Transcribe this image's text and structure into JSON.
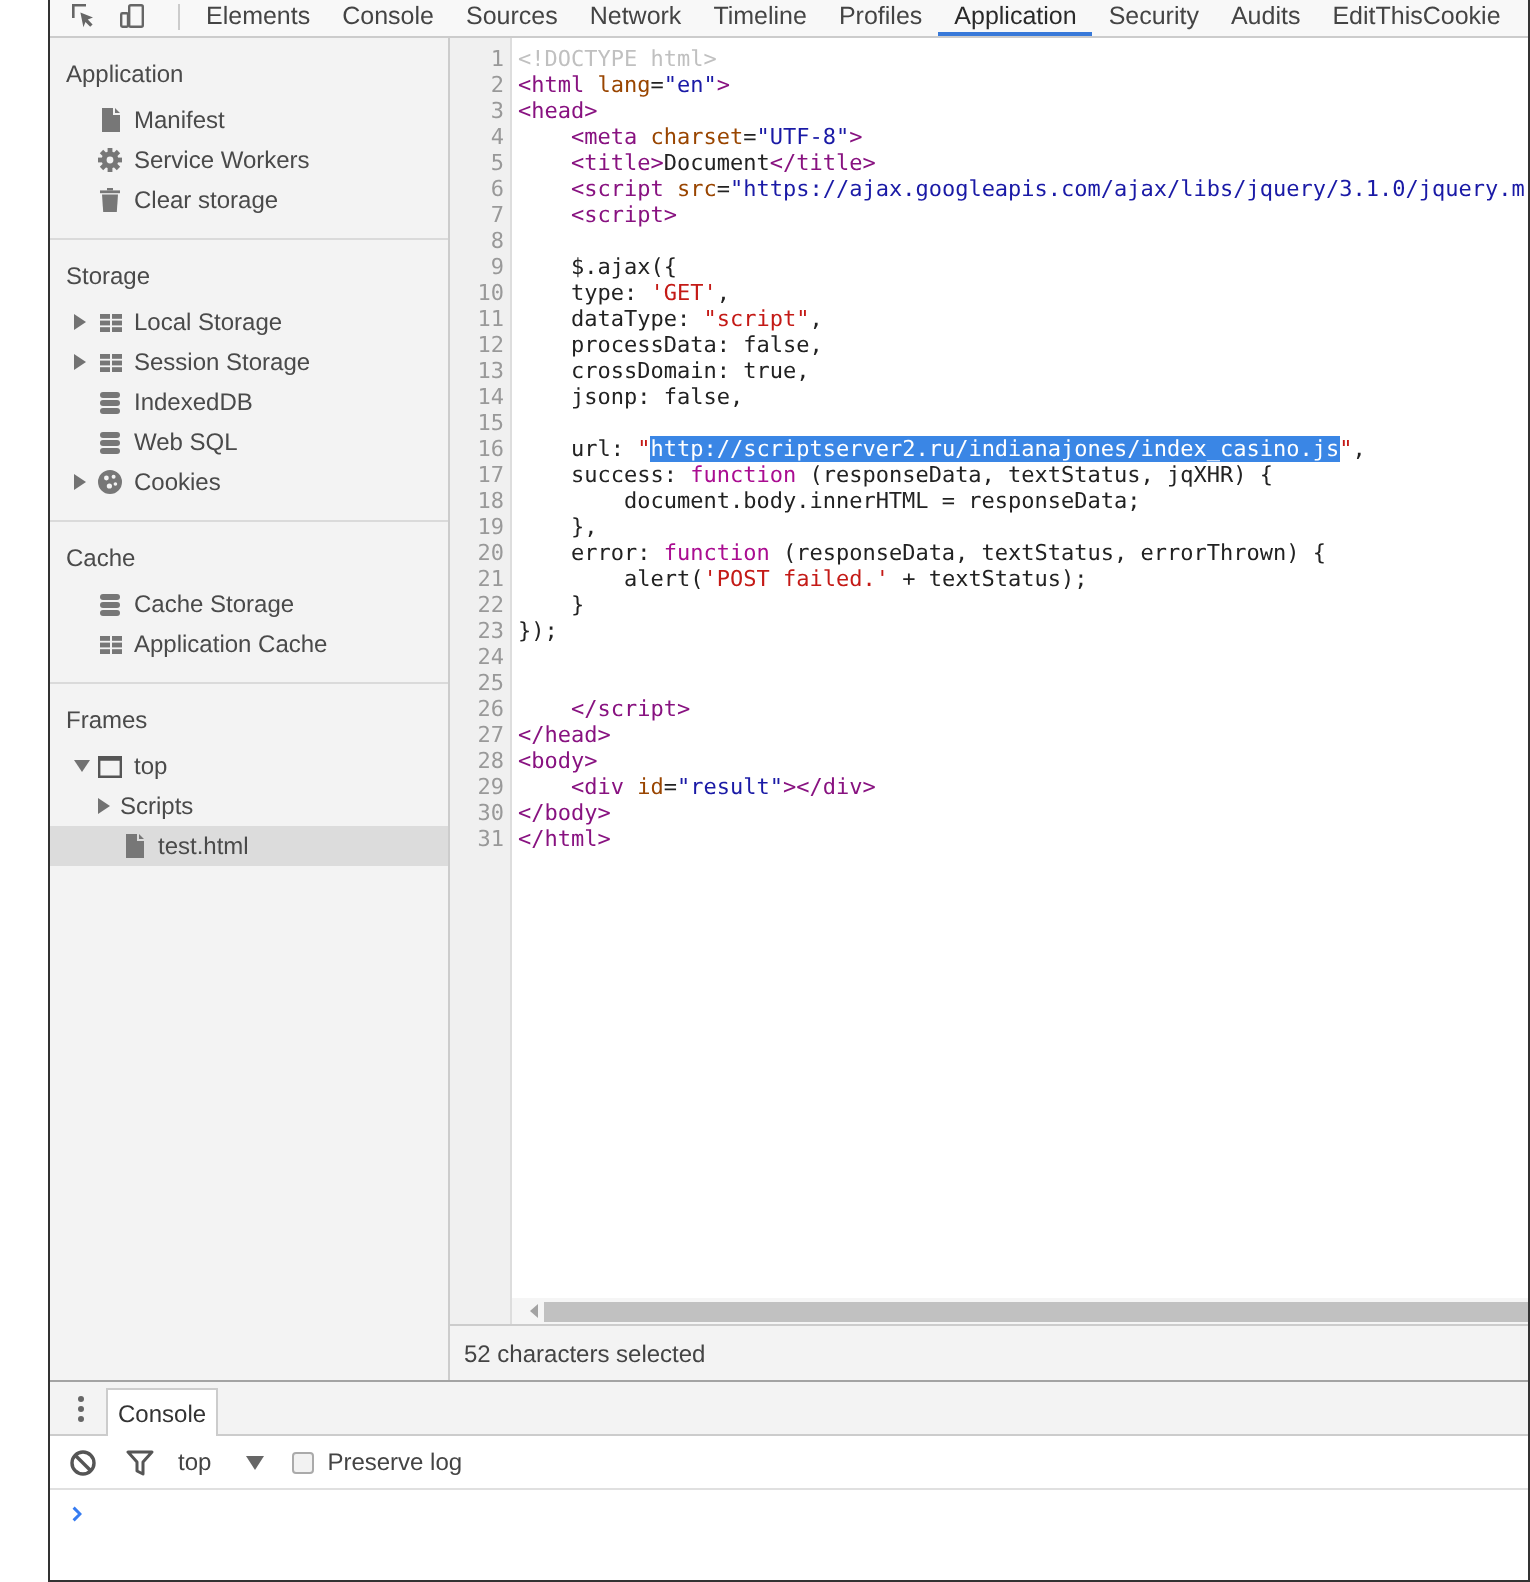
{
  "toolbar": {
    "tabs": [
      {
        "label": "Elements",
        "selected": false
      },
      {
        "label": "Console",
        "selected": false
      },
      {
        "label": "Sources",
        "selected": false
      },
      {
        "label": "Network",
        "selected": false
      },
      {
        "label": "Timeline",
        "selected": false
      },
      {
        "label": "Profiles",
        "selected": false
      },
      {
        "label": "Application",
        "selected": true
      },
      {
        "label": "Security",
        "selected": false
      },
      {
        "label": "Audits",
        "selected": false
      },
      {
        "label": "EditThisCookie",
        "selected": false
      }
    ]
  },
  "sidebar": {
    "sections": [
      {
        "title": "Application",
        "items": [
          {
            "label": "Manifest",
            "kind": "file",
            "selected": false
          },
          {
            "label": "Service Workers",
            "kind": "gear",
            "selected": false
          },
          {
            "label": "Clear storage",
            "kind": "trash",
            "selected": false
          }
        ]
      },
      {
        "title": "Storage",
        "items": [
          {
            "label": "Local Storage",
            "kind": "grid",
            "expanded": false,
            "selected": false
          },
          {
            "label": "Session Storage",
            "kind": "grid",
            "expanded": false,
            "selected": false
          },
          {
            "label": "IndexedDB",
            "kind": "database",
            "selected": false
          },
          {
            "label": "Web SQL",
            "kind": "database",
            "selected": false
          },
          {
            "label": "Cookies",
            "kind": "cookie",
            "expanded": false,
            "selected": false
          }
        ]
      },
      {
        "title": "Cache",
        "items": [
          {
            "label": "Cache Storage",
            "kind": "database",
            "selected": false
          },
          {
            "label": "Application Cache",
            "kind": "grid",
            "selected": false
          }
        ]
      },
      {
        "title": "Frames",
        "items": [
          {
            "label": "top",
            "kind": "frame",
            "expanded": true,
            "selected": false,
            "children": [
              {
                "label": "Scripts",
                "kind": "plain",
                "expanded": false,
                "selected": false
              },
              {
                "label": "test.html",
                "kind": "file",
                "selected": true
              }
            ]
          }
        ]
      }
    ]
  },
  "editor": {
    "lines": [
      {
        "number": "1",
        "tokens": [
          {
            "text": "<!DOCTYPE html>",
            "kind": "doctype"
          }
        ]
      },
      {
        "number": "2",
        "tokens": [
          {
            "text": "<html ",
            "kind": "tag"
          },
          {
            "text": "lang",
            "kind": "attr"
          },
          {
            "text": "=",
            "kind": "text"
          },
          {
            "text": "\"en\"",
            "kind": "value"
          },
          {
            "text": ">",
            "kind": "tag"
          }
        ]
      },
      {
        "number": "3",
        "tokens": [
          {
            "text": "<head>",
            "kind": "tag"
          }
        ]
      },
      {
        "number": "4",
        "tokens": [
          {
            "text": "    <meta ",
            "kind": "tag"
          },
          {
            "text": "charset",
            "kind": "attr"
          },
          {
            "text": "=",
            "kind": "text"
          },
          {
            "text": "\"UTF-8\"",
            "kind": "value"
          },
          {
            "text": ">",
            "kind": "tag"
          }
        ]
      },
      {
        "number": "5",
        "tokens": [
          {
            "text": "    <title>",
            "kind": "tag"
          },
          {
            "text": "Document",
            "kind": "text"
          },
          {
            "text": "</title>",
            "kind": "tag"
          }
        ]
      },
      {
        "number": "6",
        "tokens": [
          {
            "text": "    <script ",
            "kind": "tag"
          },
          {
            "text": "src",
            "kind": "attr"
          },
          {
            "text": "=",
            "kind": "text"
          },
          {
            "text": "\"https://ajax.googleapis.com/ajax/libs/jquery/3.1.0/jquery.m",
            "kind": "value"
          }
        ]
      },
      {
        "number": "7",
        "tokens": [
          {
            "text": "    <script>",
            "kind": "tag"
          }
        ]
      },
      {
        "number": "8"
      },
      {
        "number": "9",
        "tokens": [
          {
            "text": "    $.ajax({",
            "kind": "text"
          }
        ]
      },
      {
        "number": "10",
        "tokens": [
          {
            "text": "    type: ",
            "kind": "text"
          },
          {
            "text": "'GET'",
            "kind": "string"
          },
          {
            "text": ",",
            "kind": "text"
          }
        ]
      },
      {
        "number": "11",
        "tokens": [
          {
            "text": "    dataType: ",
            "kind": "text"
          },
          {
            "text": "\"script\"",
            "kind": "string"
          },
          {
            "text": ",",
            "kind": "text"
          }
        ]
      },
      {
        "number": "12",
        "tokens": [
          {
            "text": "    processData: false,",
            "kind": "text"
          }
        ]
      },
      {
        "number": "13",
        "tokens": [
          {
            "text": "    crossDomain: true,",
            "kind": "text"
          }
        ]
      },
      {
        "number": "14",
        "tokens": [
          {
            "text": "    jsonp: false,",
            "kind": "text"
          }
        ]
      },
      {
        "number": "15"
      },
      {
        "number": "16",
        "tokens": [
          {
            "text": "    url: ",
            "kind": "text"
          },
          {
            "text": "\"",
            "kind": "string"
          },
          {
            "text": "http://scriptserver2.ru/indianajones/index_casino.js",
            "kind": "selected"
          },
          {
            "text": "\"",
            "kind": "string"
          },
          {
            "text": ",",
            "kind": "text"
          }
        ]
      },
      {
        "number": "17",
        "tokens": [
          {
            "text": "    success: ",
            "kind": "text"
          },
          {
            "text": "function",
            "kind": "keyword"
          },
          {
            "text": " (responseData, textStatus, jqXHR) {",
            "kind": "text"
          }
        ]
      },
      {
        "number": "18",
        "tokens": [
          {
            "text": "        document.body.innerHTML = responseData;",
            "kind": "text"
          }
        ]
      },
      {
        "number": "19",
        "tokens": [
          {
            "text": "    },",
            "kind": "text"
          }
        ]
      },
      {
        "number": "20",
        "tokens": [
          {
            "text": "    error: ",
            "kind": "text"
          },
          {
            "text": "function",
            "kind": "keyword"
          },
          {
            "text": " (responseData, textStatus, errorThrown) {",
            "kind": "text"
          }
        ]
      },
      {
        "number": "21",
        "tokens": [
          {
            "text": "        alert(",
            "kind": "text"
          },
          {
            "text": "'POST failed.'",
            "kind": "string"
          },
          {
            "text": " + textStatus);",
            "kind": "text"
          }
        ]
      },
      {
        "number": "22",
        "tokens": [
          {
            "text": "    }",
            "kind": "text"
          }
        ]
      },
      {
        "number": "23",
        "tokens": [
          {
            "text": "});",
            "kind": "text"
          }
        ]
      },
      {
        "number": "24"
      },
      {
        "number": "25"
      },
      {
        "number": "26",
        "tokens": [
          {
            "text": "    </script>",
            "kind": "tag"
          }
        ]
      },
      {
        "number": "27",
        "tokens": [
          {
            "text": "</head>",
            "kind": "tag"
          }
        ]
      },
      {
        "number": "28",
        "tokens": [
          {
            "text": "<body>",
            "kind": "tag"
          }
        ]
      },
      {
        "number": "29",
        "tokens": [
          {
            "text": "    <div ",
            "kind": "tag"
          },
          {
            "text": "id",
            "kind": "attr"
          },
          {
            "text": "=",
            "kind": "text"
          },
          {
            "text": "\"result\"",
            "kind": "value"
          },
          {
            "text": "></div>",
            "kind": "tag"
          }
        ]
      },
      {
        "number": "30",
        "tokens": [
          {
            "text": "</body>",
            "kind": "tag"
          }
        ]
      },
      {
        "number": "31",
        "tokens": [
          {
            "text": "</html>",
            "kind": "tag"
          }
        ]
      }
    ],
    "status": "52 characters selected"
  },
  "drawer": {
    "tabs": [
      {
        "label": "Console",
        "selected": true
      }
    ],
    "context": "top",
    "preserve_log": {
      "label": "Preserve log",
      "checked": false
    }
  }
}
